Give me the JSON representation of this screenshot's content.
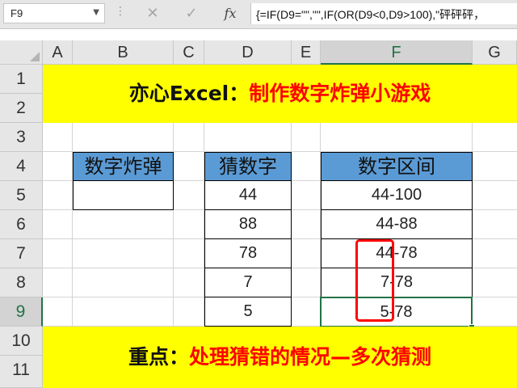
{
  "formula_bar": {
    "name_box": "F9",
    "cancel_icon": "✕",
    "confirm_icon": "✓",
    "fx_icon": "fx",
    "formula": "{=IF(D9=\"\",\"\",IF(OR(D9<0,D9>100),\"砰砰砰，"
  },
  "columns": [
    "A",
    "B",
    "C",
    "D",
    "E",
    "F",
    "G"
  ],
  "active_column": "F",
  "rows": [
    "1",
    "2",
    "3",
    "4",
    "5",
    "6",
    "7",
    "8",
    "9",
    "10",
    "11"
  ],
  "active_row": "9",
  "title_banner": {
    "black": "亦心Excel：",
    "red": "制作数字炸弹小游戏"
  },
  "bottom_banner": {
    "black": "重点：",
    "red": "处理猜错的情况—多次猜测"
  },
  "table": {
    "bomb_header": "数字炸弹",
    "bomb_value": "",
    "guess_header": "猜数字",
    "range_header": "数字区间",
    "guesses": [
      "44",
      "88",
      "78",
      "7",
      "5"
    ],
    "ranges": [
      "44-100",
      "44-88",
      "44-78",
      "7-78",
      "5-78"
    ]
  },
  "colors": {
    "header_fill": "#5b9bd5",
    "banner_fill": "#ffff00",
    "highlight": "#ff0000",
    "selection": "#217346"
  }
}
